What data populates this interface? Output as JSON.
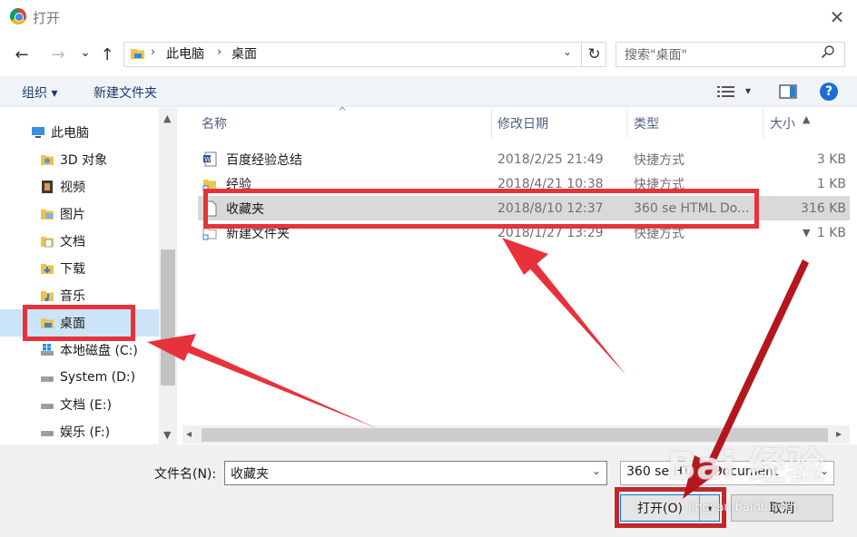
{
  "window": {
    "title": "打开",
    "close_glyph": "✕"
  },
  "nav": {
    "back_glyph": "←",
    "forward_glyph": "→",
    "recent_glyph": "⌄",
    "up_glyph": "↑",
    "breadcrumbs": [
      "此电脑",
      "桌面"
    ],
    "crumb_sep": "›",
    "refresh_glyph": "↻",
    "search_placeholder": "搜索\"桌面\""
  },
  "toolbar": {
    "organize": "组织 ▾",
    "new_folder": "新建文件夹",
    "view_drop": "▾",
    "help": "?"
  },
  "sidebar": {
    "items": [
      {
        "label": "此电脑",
        "icon": "pc-icon"
      },
      {
        "label": "3D 对象",
        "icon": "objects-3d-icon"
      },
      {
        "label": "视频",
        "icon": "video-icon"
      },
      {
        "label": "图片",
        "icon": "pictures-icon"
      },
      {
        "label": "文档",
        "icon": "documents-icon"
      },
      {
        "label": "下载",
        "icon": "downloads-icon"
      },
      {
        "label": "音乐",
        "icon": "music-icon"
      },
      {
        "label": "桌面",
        "icon": "desktop-icon",
        "selected": true
      },
      {
        "label": "本地磁盘 (C:)",
        "icon": "drive-windows-icon"
      },
      {
        "label": "System (D:)",
        "icon": "drive-icon"
      },
      {
        "label": "文档 (E:)",
        "icon": "drive-icon"
      },
      {
        "label": "娱乐 (F:)",
        "icon": "drive-icon"
      }
    ],
    "scroll_up": "▲",
    "scroll_down": "▼"
  },
  "file_list": {
    "columns": {
      "name": "名称",
      "modified": "修改日期",
      "type": "类型",
      "size": "大小"
    },
    "sort_glyph": "^",
    "rows": [
      {
        "name": "百度经验总结",
        "modified": "2018/2/25 21:49",
        "type": "快捷方式",
        "size": "3 KB",
        "icon": "word-shortcut-icon"
      },
      {
        "name": "经验",
        "modified": "2018/4/21 10:38",
        "type": "快捷方式",
        "size": "1 KB",
        "icon": "folder-shortcut-icon"
      },
      {
        "name": "收藏夹",
        "modified": "2018/8/10 12:37",
        "type": "360 se HTML Do...",
        "size": "316 KB",
        "icon": "html-file-icon",
        "selected": true
      },
      {
        "name": "新建文件夹",
        "modified": "2018/1/27 13:29",
        "type": "快捷方式",
        "size": "1 KB",
        "icon": "folder-shortcut-icon"
      }
    ],
    "hscroll_left": "◂",
    "hscroll_right": "▸",
    "vscroll_up": "▲",
    "vscroll_down": "▼"
  },
  "footer": {
    "filename_label": "文件名(N):",
    "filename_value": "收藏夹",
    "filename_drop": "⌄",
    "filetype_value": "360 se HTML Document",
    "filetype_drop": "⌄",
    "open_label": "打开(O)",
    "open_split": "▾",
    "cancel_label": "取消"
  },
  "watermark": {
    "logo": "Bai  经验",
    "url": "jingyan.baidu.com"
  },
  "colors": {
    "accent": "#0078d7",
    "highlight": "#e8323b",
    "selection": "#cce4f7"
  }
}
